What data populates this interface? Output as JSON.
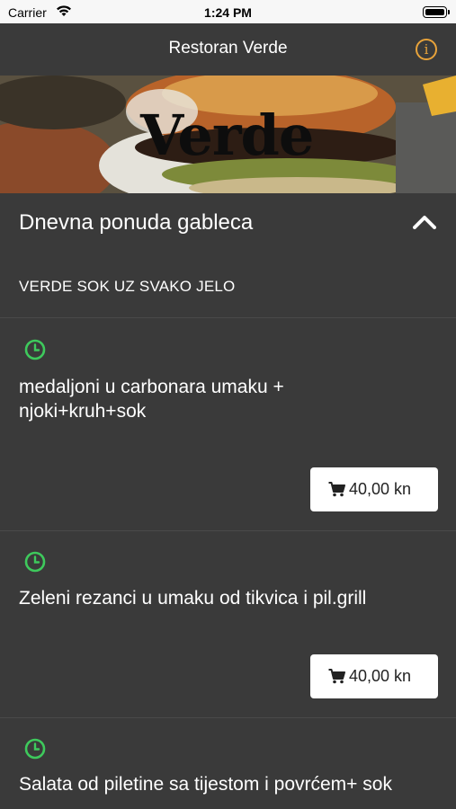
{
  "status_bar": {
    "carrier": "Carrier",
    "time": "1:24 PM"
  },
  "navbar": {
    "title": "Restoran Verde",
    "info_icon": "info-icon"
  },
  "banner": {
    "logo_text": "Verde"
  },
  "section": {
    "title": "Dnevna ponuda gableca",
    "notice": "VERDE SOK UZ SVAKO JELO",
    "collapse_icon": "chevron-up-icon"
  },
  "menu_items": [
    {
      "name": "medaljoni u carbonara umaku + njoki+kruh+sok",
      "price": "40,00 kn"
    },
    {
      "name": "Zeleni rezanci u umaku od tikvica i pil.grill",
      "price": "40,00 kn"
    },
    {
      "name": "Salata od piletine sa tijestom i povrćem+ sok",
      "price": ""
    }
  ],
  "colors": {
    "background": "#3a3a3a",
    "accent_orange": "#e8a33a",
    "clock_green": "#3ec95c"
  }
}
